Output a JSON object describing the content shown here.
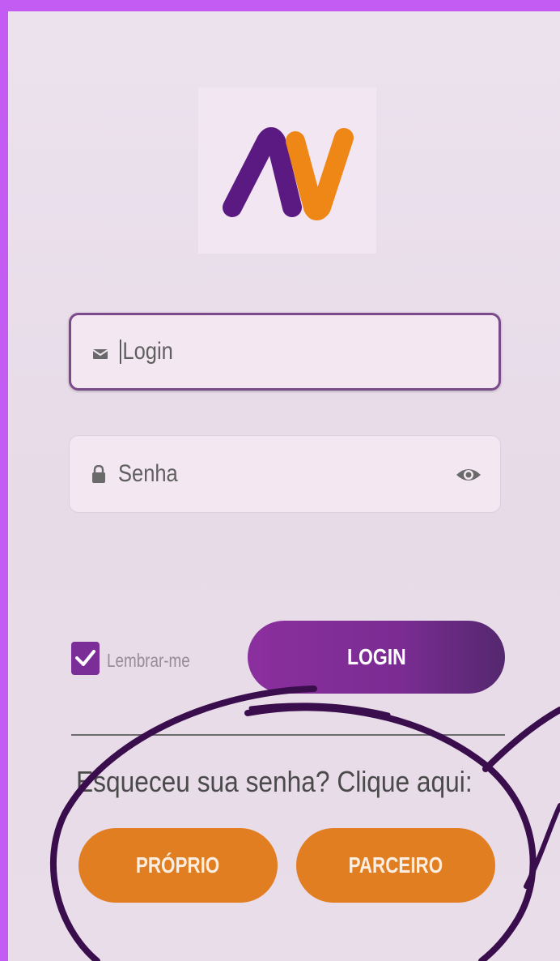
{
  "app": {
    "logo_text": "AV",
    "logo_colors": {
      "left": "#5b1a82",
      "right": "#ee8716"
    }
  },
  "form": {
    "login_placeholder": "Login",
    "password_placeholder": "Senha",
    "login_icon": "envelope-icon",
    "password_icon": "lock-icon",
    "visibility_icon": "eye-icon"
  },
  "remember": {
    "label": "Lembrar-me",
    "checked": true
  },
  "buttons": {
    "login": "LOGIN",
    "proprio": "PRÓPRIO",
    "parceiro": "PARCEIRO"
  },
  "forgot_text": "Esqueceu sua senha? Clique aqui:",
  "colors": {
    "background": "#c35cf3",
    "primary": "#7b2e97",
    "accent": "#e27e22",
    "annotation": "#3a0d4d"
  }
}
